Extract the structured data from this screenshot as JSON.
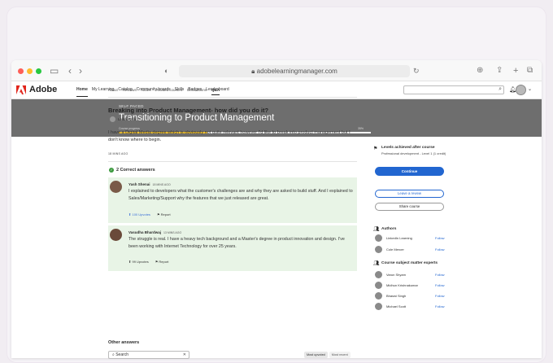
{
  "browser": {
    "url": "adobelearningmanager.com"
  },
  "app": {
    "brand": "Adobe",
    "nav": [
      "Home",
      "My Learning",
      "Catalog",
      "Community boards",
      "Skills",
      "Badges",
      "Leaderboard"
    ]
  },
  "banner": {
    "tag": "SELF PACED",
    "title": "Transitioning to Product Management",
    "progress_label": "Course progress",
    "progress_text": "35%",
    "progress_value": 0.35
  },
  "tabs": [
    "About",
    "Reviews",
    "Notes",
    "Related courses",
    "Discussions",
    "Q&A"
  ],
  "question": {
    "title": "Breaking into Product Management- how did you do it?",
    "author": "Lalita Kalla",
    "body": "I have a Digital Media degree which is obviously not quite relevant however I'd like to break into product management but I don't know where to begin.",
    "time": "18 MINS AGO"
  },
  "correct": {
    "title": "2 Correct answers",
    "answers": [
      {
        "name": "Yash Shenai",
        "time": "18 MINS AGO",
        "body": "I explained to developers what the customer's challenges are and why they are asked to build stuff. And I explained to Sales/Marketing/Support why the features that we just released are great.",
        "upvotes": "100 Upvotes",
        "report": "Report"
      },
      {
        "name": "Vasudha Bhardwaj",
        "time": "13 MINS AGO",
        "body": "The struggle is real. I have a heavy tech background and a Master's degree in product innovation and design. I've been working with Internet Technology for over 25 years.",
        "upvotes": "99 Upvotes",
        "report": "Report"
      }
    ]
  },
  "other": {
    "title": "Other answers",
    "search_placeholder": "Search",
    "sort": [
      "Most upvoted",
      "Most recent"
    ]
  },
  "sidebar": {
    "levels_title": "Levels achieved after course",
    "levels_sub": "Professional development - Level 1 (1 credit)",
    "continue": "Continue",
    "review": "Leave a review",
    "share": "Share course",
    "authors_title": "Authors",
    "authors": [
      {
        "name": "LinkedIn Learning",
        "follow": "Follow"
      },
      {
        "name": "Cole Mercer",
        "follow": "Follow"
      }
    ],
    "sme_title": "Course subject matter experts",
    "experts": [
      {
        "name": "Varun Shyam",
        "follow": "Follow"
      },
      {
        "name": "Midhun Krishnakumar",
        "follow": "Follow"
      },
      {
        "name": "Bhaswi Singh",
        "follow": "Follow"
      },
      {
        "name": "Michael Scott",
        "follow": "Follow"
      }
    ]
  }
}
